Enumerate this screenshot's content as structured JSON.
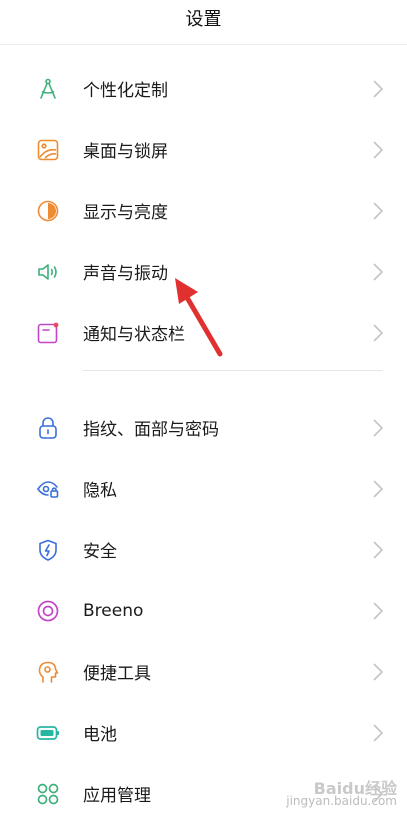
{
  "header": {
    "title": "设置"
  },
  "colors": {
    "accent_green": "#3cb07a",
    "accent_orange": "#ef8b33",
    "accent_blue": "#3a6fd8",
    "accent_purple": "#c146c9",
    "arrow_red": "#e03030"
  },
  "section1": [
    {
      "label": "个性化定制",
      "icon": "compass-icon"
    },
    {
      "label": "桌面与锁屏",
      "icon": "wallpaper-icon"
    },
    {
      "label": "显示与亮度",
      "icon": "brightness-icon"
    },
    {
      "label": "声音与振动",
      "icon": "speaker-icon"
    },
    {
      "label": "通知与状态栏",
      "icon": "notification-icon"
    }
  ],
  "section2": [
    {
      "label": "指纹、面部与密码",
      "icon": "lock-icon"
    },
    {
      "label": "隐私",
      "icon": "privacy-eye-icon"
    },
    {
      "label": "安全",
      "icon": "shield-icon"
    },
    {
      "label": "Breeno",
      "icon": "breeno-icon"
    },
    {
      "label": "便捷工具",
      "icon": "tools-icon"
    },
    {
      "label": "电池",
      "icon": "battery-icon"
    },
    {
      "label": "应用管理",
      "icon": "apps-icon"
    }
  ],
  "watermark": {
    "line1": "Baidu经验",
    "line2": "jingyan.baidu.com"
  }
}
